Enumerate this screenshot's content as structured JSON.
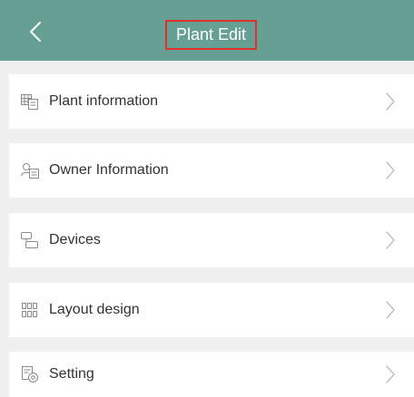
{
  "header": {
    "title": "Plant Edit",
    "back_icon": "chevron-left-icon",
    "background_color": "#66a094",
    "highlight_color": "#e0302c"
  },
  "menu": {
    "items": [
      {
        "label": "Plant information",
        "icon": "plant-grid-icon"
      },
      {
        "label": "Owner Information",
        "icon": "owner-card-icon"
      },
      {
        "label": "Devices",
        "icon": "devices-icon"
      },
      {
        "label": "Layout design",
        "icon": "layout-grid-icon"
      },
      {
        "label": "Setting",
        "icon": "settings-icon"
      }
    ],
    "chevron_icon": "chevron-right-icon"
  }
}
